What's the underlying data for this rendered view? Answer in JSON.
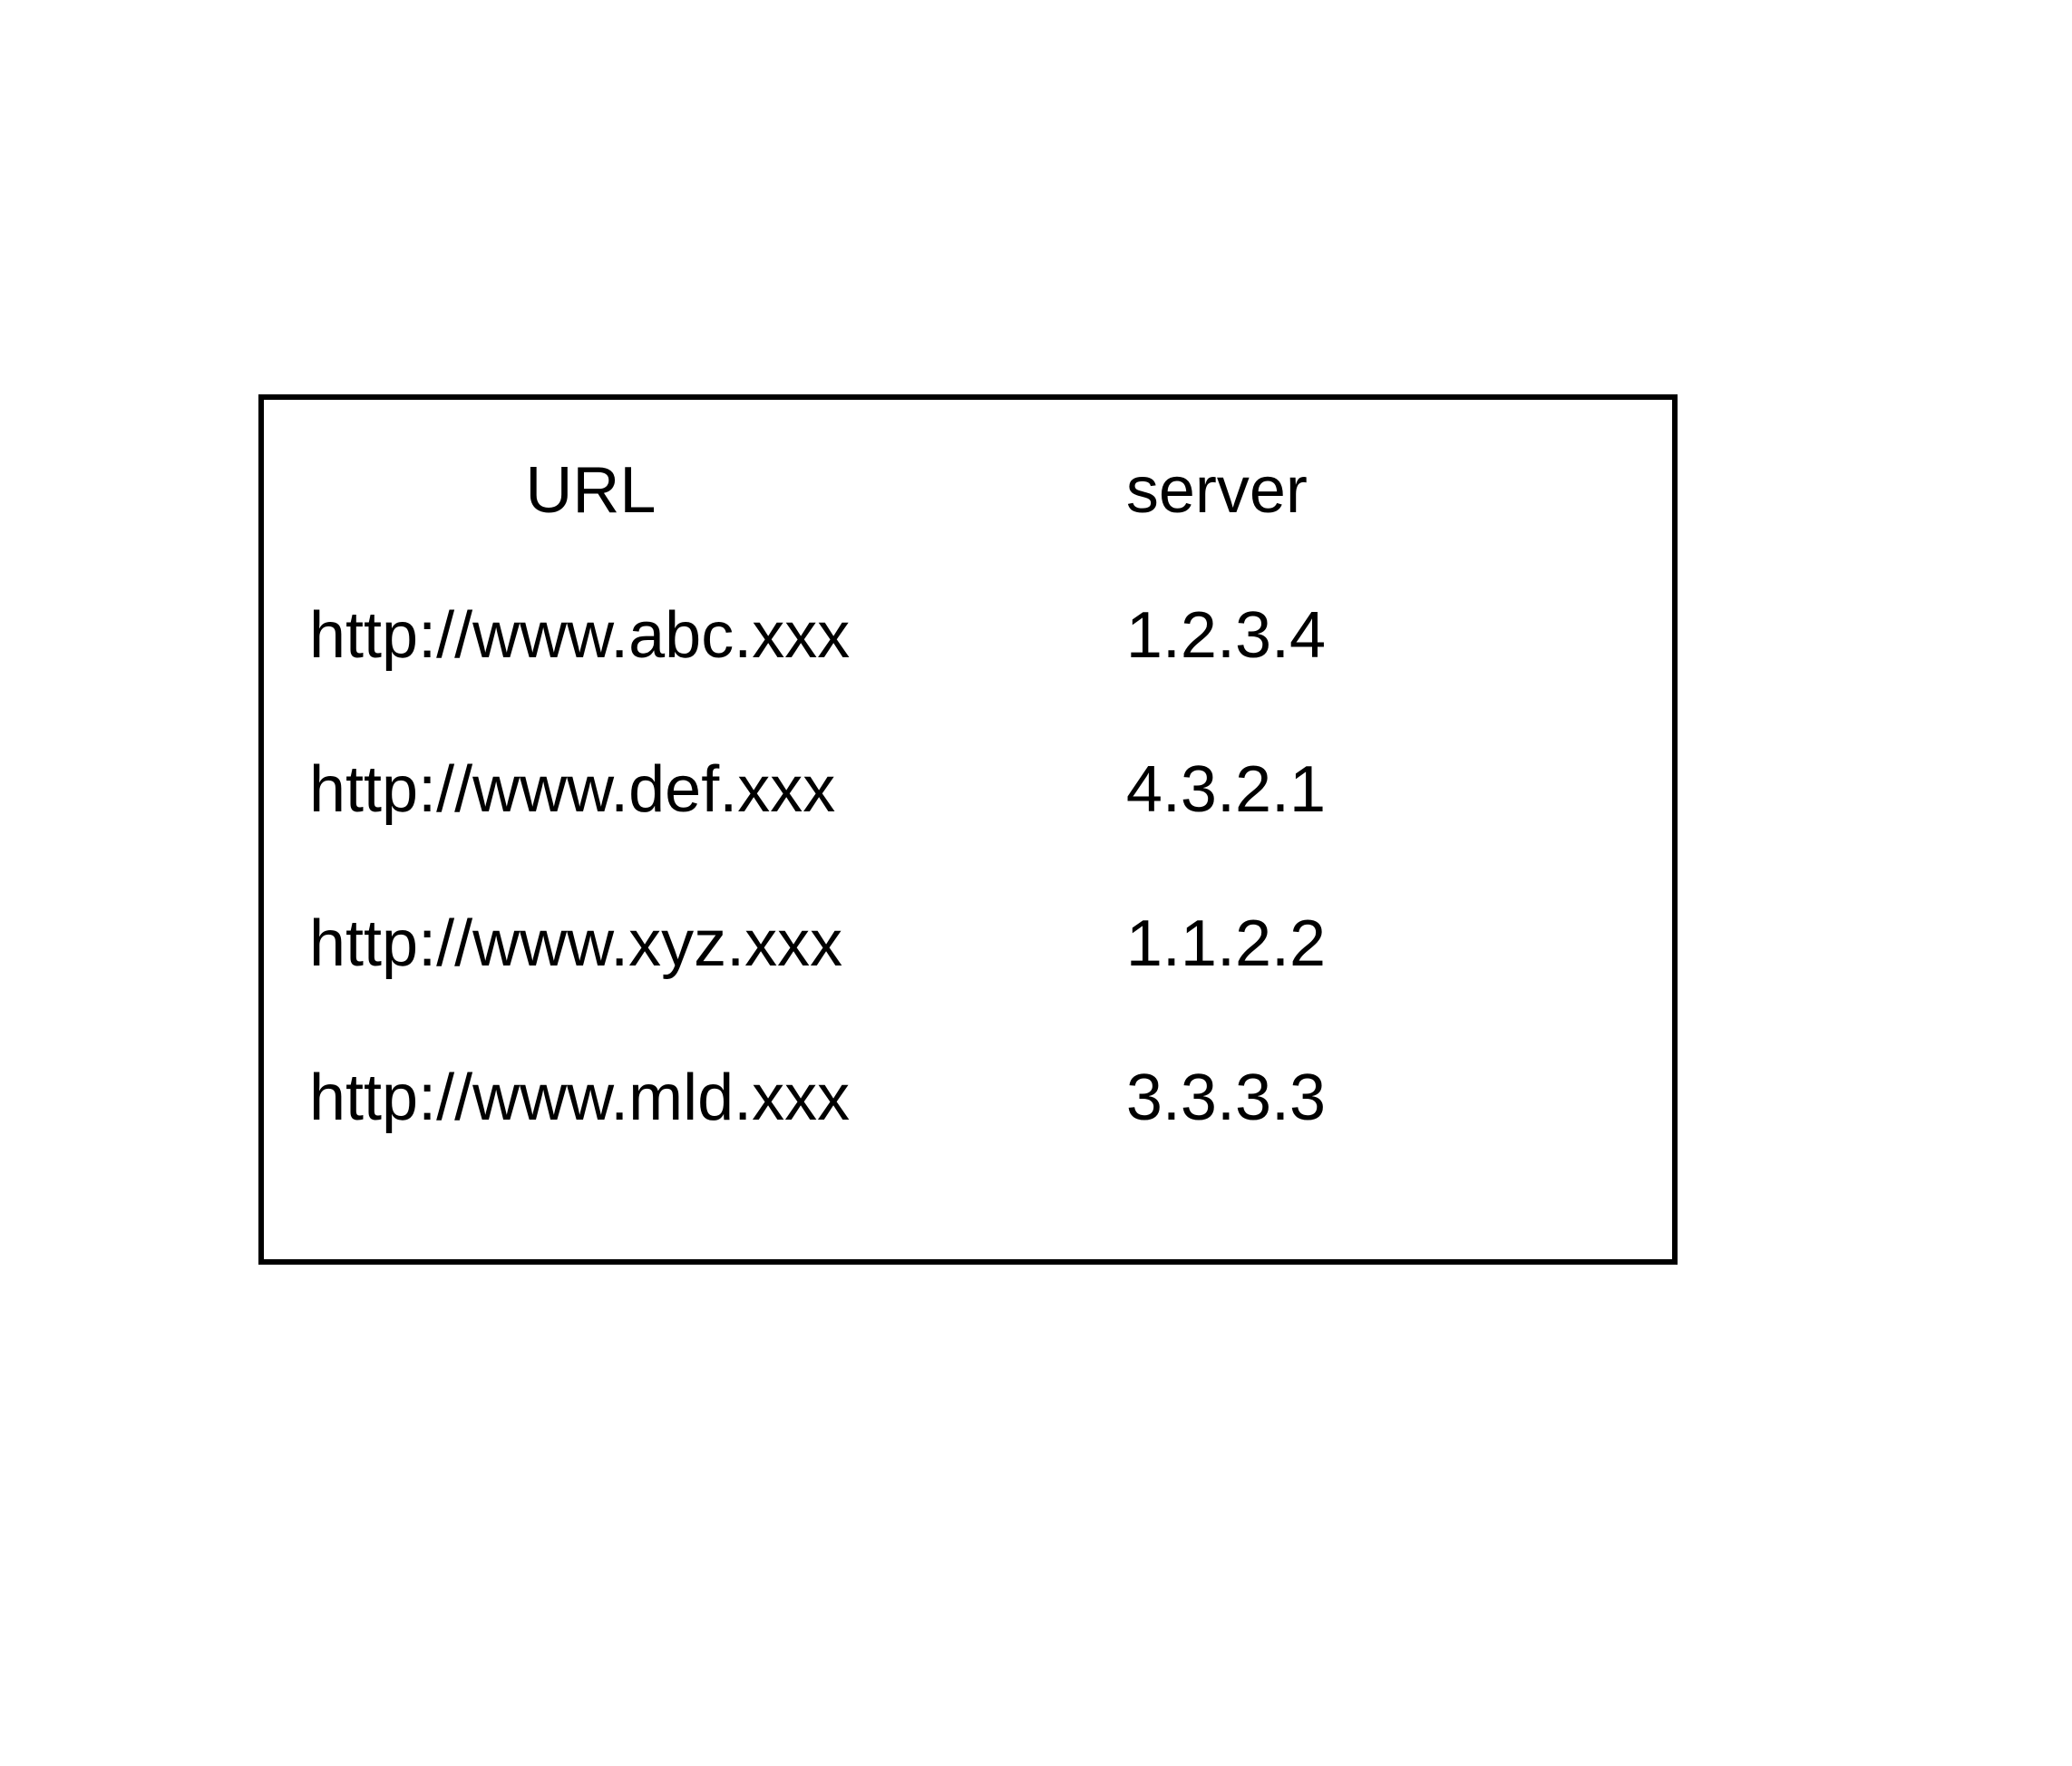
{
  "table": {
    "headers": {
      "url": "URL",
      "server": "server"
    },
    "rows": [
      {
        "url": "http://www.abc.xxx",
        "server": "1.2.3.4"
      },
      {
        "url": "http://www.def.xxx",
        "server": "4.3.2.1"
      },
      {
        "url": "http://www.xyz.xxx",
        "server": "1.1.2.2"
      },
      {
        "url": "http://www.mld.xxx",
        "server": "3.3.3.3"
      }
    ]
  }
}
